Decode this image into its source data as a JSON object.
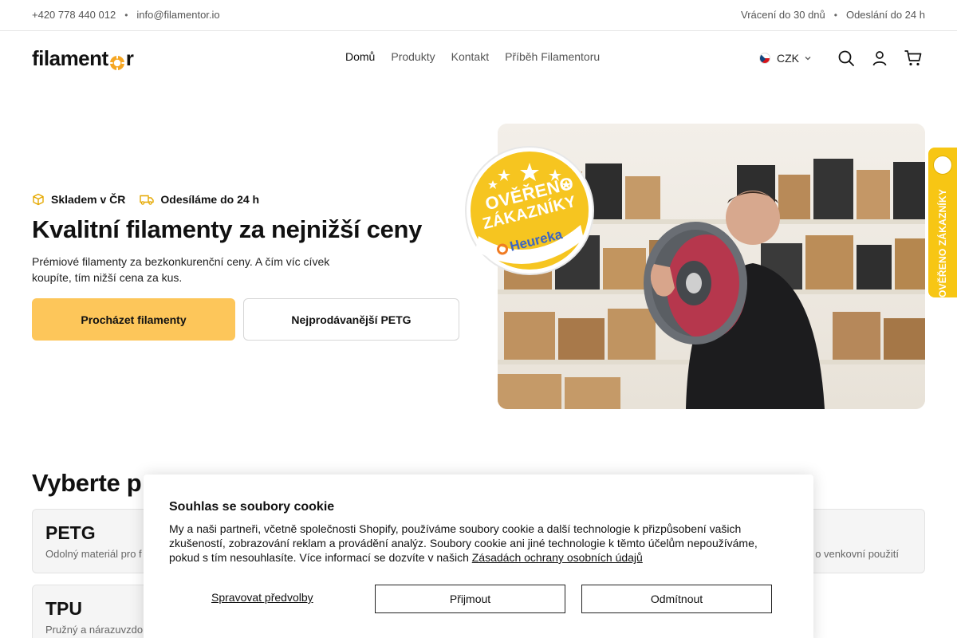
{
  "topbar": {
    "phone": "+420 778 440 012",
    "email": "info@filamentor.io",
    "returns": "Vrácení do 30 dnů",
    "shipping": "Odeslání do 24 h",
    "separator": "•"
  },
  "header": {
    "logo_pre": "filament",
    "logo_post": "r",
    "nav": [
      "Domů",
      "Produkty",
      "Kontakt",
      "Příběh Filamentoru"
    ],
    "currency": "CZK",
    "icons": [
      "czech-flag-icon",
      "chevron-down-icon",
      "search-icon",
      "user-icon",
      "cart-icon"
    ]
  },
  "hero": {
    "badge_stock": "Skladem v ČR",
    "badge_ship": "Odesíláme do 24 h",
    "title": "Kvalitní filamenty za nejnižší ceny",
    "subtitle": "Prémiové filamenty za bezkonkurenční ceny. A čím víc cívek koupíte, tím nižší cena za kus.",
    "btn_primary": "Procházet filamenty",
    "btn_secondary": "Nejprodávanější PETG",
    "seal_line1": "OVĚŘENO",
    "seal_line2": "ZÁKAZNÍKY",
    "seal_brand": "Heureka"
  },
  "sidetab": {
    "label": "OVĚŘENO ZÁKAZNÍKY"
  },
  "categories": {
    "title": "Vyberte p",
    "items": [
      {
        "name": "PETG",
        "desc": "Odolný materiál pro f"
      },
      {
        "name": "",
        "desc": "o venkovní použití"
      },
      {
        "name": "TPU",
        "desc": "Pružný a nárazuvzdo"
      }
    ]
  },
  "cookie": {
    "title": "Souhlas se soubory cookie",
    "body": "My a naši partneři, včetně společnosti Shopify, používáme soubory cookie a další technologie k přizpůsobení vašich zkušeností, zobrazování reklam a provádění analýz. Soubory cookie ani jiné technologie k těmto účelům nepoužíváme, pokud s tím nesouhlasíte. Více informací se dozvíte v našich ",
    "link": "Zásadách ochrany osobních údajů",
    "manage": "Spravovat předvolby",
    "accept": "Přijmout",
    "reject": "Odmítnout"
  },
  "colors": {
    "accent": "#fdc65a",
    "heureka_yellow": "#f7c614",
    "text": "#111111"
  }
}
